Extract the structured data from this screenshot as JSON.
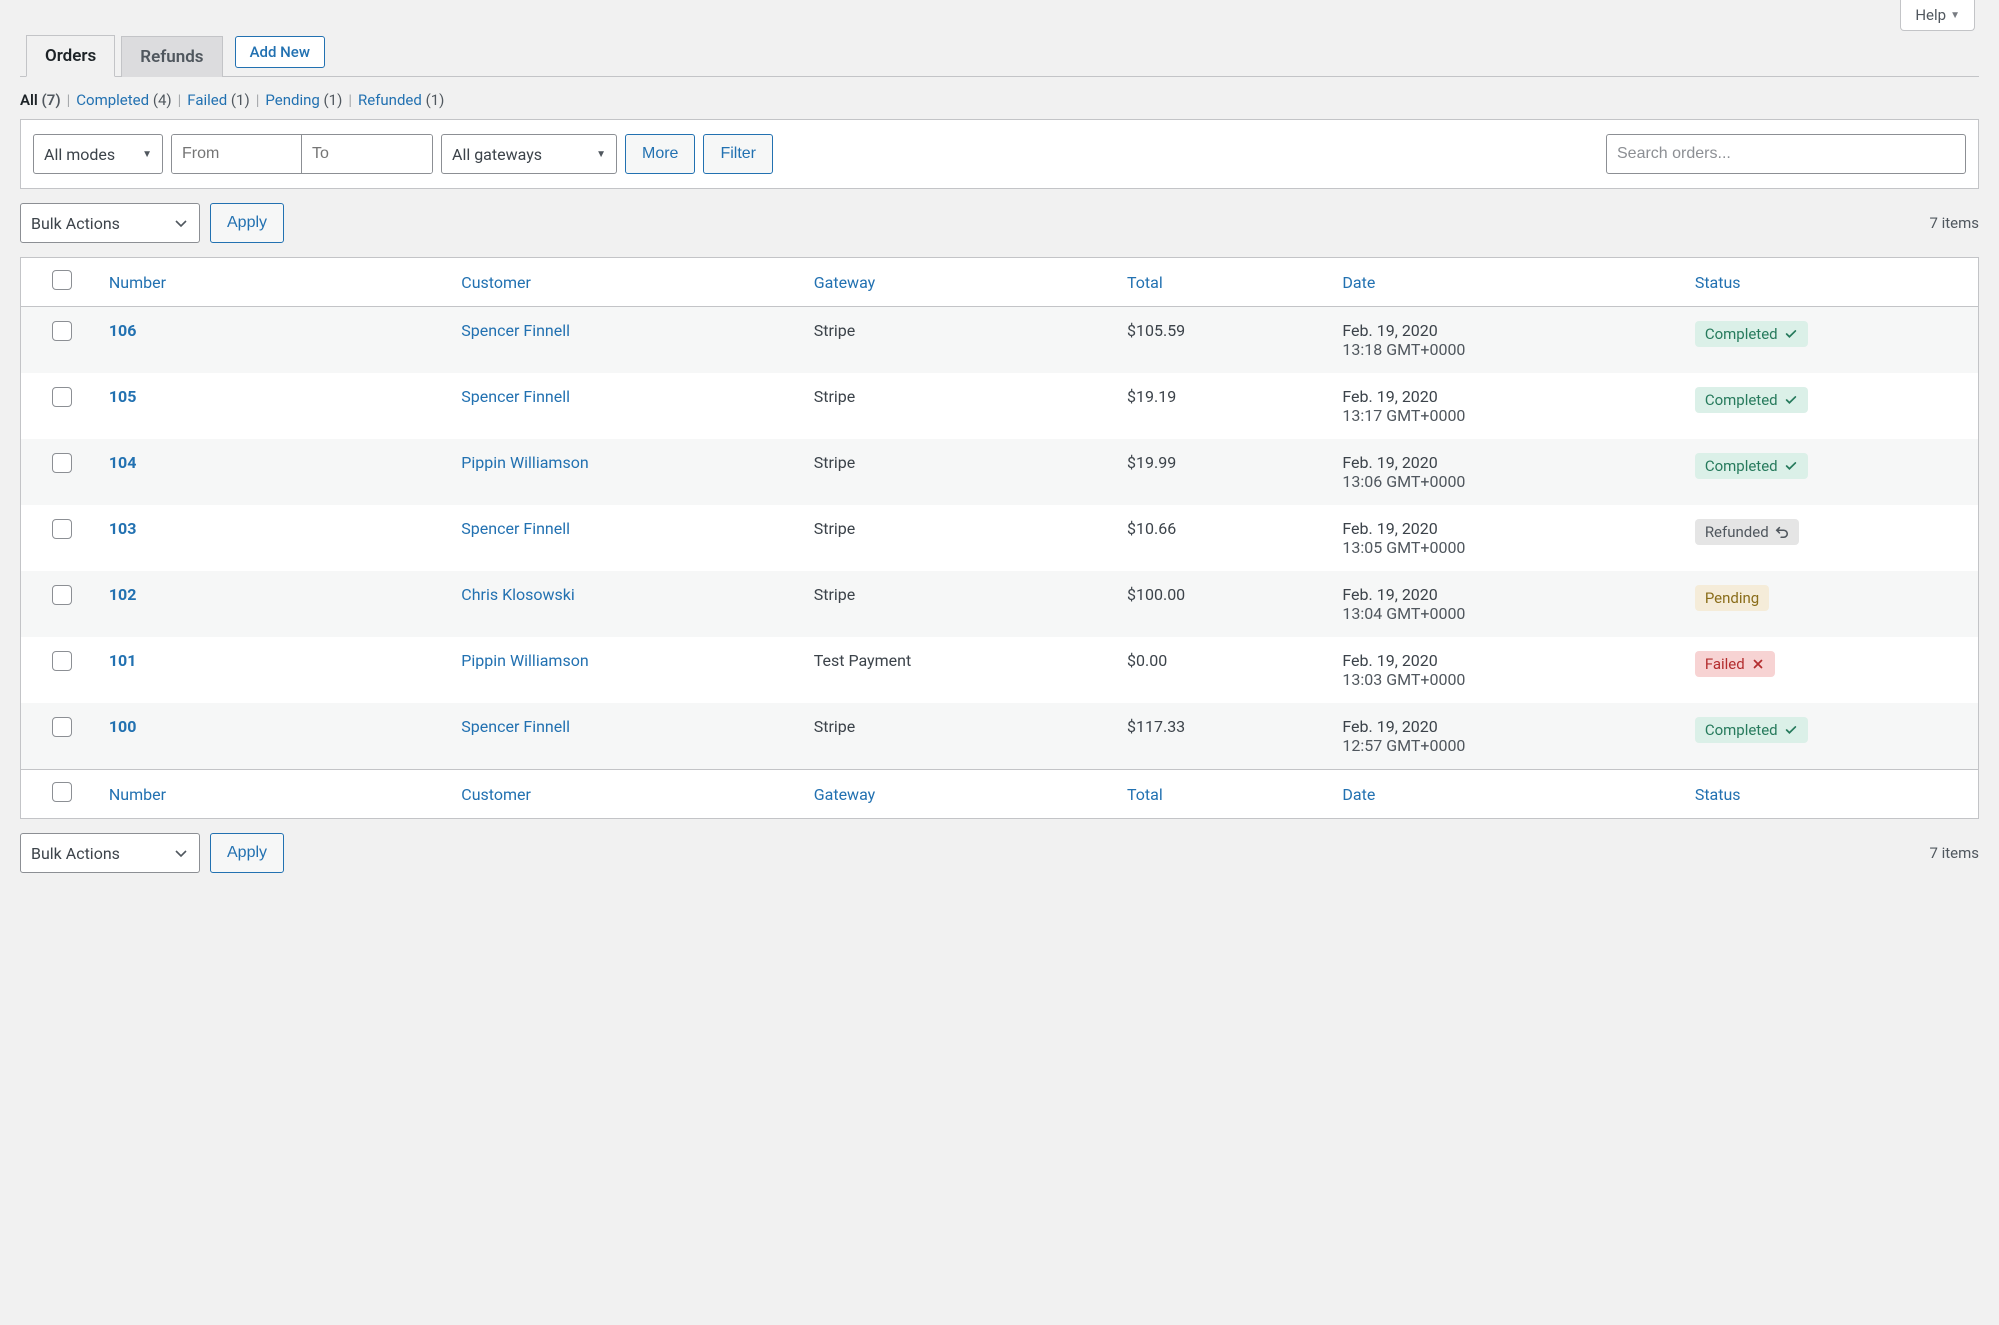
{
  "help_label": "Help",
  "tabs": {
    "orders": "Orders",
    "refunds": "Refunds"
  },
  "add_new_label": "Add New",
  "status_filters": [
    {
      "label": "All",
      "count": "(7)",
      "current": true
    },
    {
      "label": "Completed",
      "count": "(4)",
      "current": false
    },
    {
      "label": "Failed",
      "count": "(1)",
      "current": false
    },
    {
      "label": "Pending",
      "count": "(1)",
      "current": false
    },
    {
      "label": "Refunded",
      "count": "(1)",
      "current": false
    }
  ],
  "filters": {
    "modes_label": "All modes",
    "from_placeholder": "From",
    "to_placeholder": "To",
    "gateways_label": "All gateways",
    "more_label": "More",
    "filter_label": "Filter",
    "search_placeholder": "Search orders..."
  },
  "bulk": {
    "select_label": "Bulk Actions",
    "apply_label": "Apply"
  },
  "items_count": "7 items",
  "columns": {
    "number": "Number",
    "customer": "Customer",
    "gateway": "Gateway",
    "total": "Total",
    "date": "Date",
    "status": "Status"
  },
  "rows": [
    {
      "number": "106",
      "customer": "Spencer Finnell",
      "gateway": "Stripe",
      "total": "$105.59",
      "date1": "Feb. 19, 2020",
      "date2": "13:18 GMT+0000",
      "status": "Completed",
      "status_class": "completed"
    },
    {
      "number": "105",
      "customer": "Spencer Finnell",
      "gateway": "Stripe",
      "total": "$19.19",
      "date1": "Feb. 19, 2020",
      "date2": "13:17 GMT+0000",
      "status": "Completed",
      "status_class": "completed"
    },
    {
      "number": "104",
      "customer": "Pippin Williamson",
      "gateway": "Stripe",
      "total": "$19.99",
      "date1": "Feb. 19, 2020",
      "date2": "13:06 GMT+0000",
      "status": "Completed",
      "status_class": "completed"
    },
    {
      "number": "103",
      "customer": "Spencer Finnell",
      "gateway": "Stripe",
      "total": "$10.66",
      "date1": "Feb. 19, 2020",
      "date2": "13:05 GMT+0000",
      "status": "Refunded",
      "status_class": "refunded"
    },
    {
      "number": "102",
      "customer": "Chris Klosowski",
      "gateway": "Stripe",
      "total": "$100.00",
      "date1": "Feb. 19, 2020",
      "date2": "13:04 GMT+0000",
      "status": "Pending",
      "status_class": "pending"
    },
    {
      "number": "101",
      "customer": "Pippin Williamson",
      "gateway": "Test Payment",
      "total": "$0.00",
      "date1": "Feb. 19, 2020",
      "date2": "13:03 GMT+0000",
      "status": "Failed",
      "status_class": "failed"
    },
    {
      "number": "100",
      "customer": "Spencer Finnell",
      "gateway": "Stripe",
      "total": "$117.33",
      "date1": "Feb. 19, 2020",
      "date2": "12:57 GMT+0000",
      "status": "Completed",
      "status_class": "completed"
    }
  ]
}
